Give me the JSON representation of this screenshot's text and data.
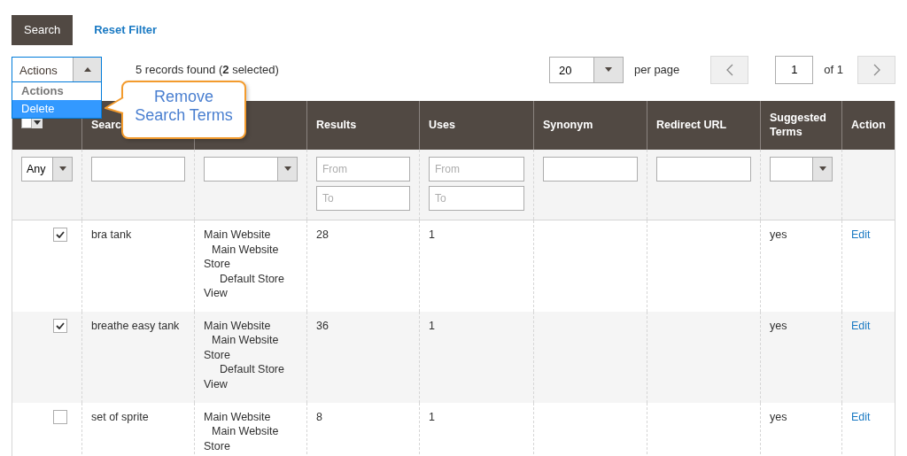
{
  "toolbar": {
    "search_button": "Search",
    "reset_link": "Reset Filter"
  },
  "actions": {
    "label": "Actions",
    "expanded": true,
    "options": [
      {
        "label": "Actions",
        "selected": false
      },
      {
        "label": "Delete",
        "selected": true
      }
    ]
  },
  "records_info": "5 records found (**2** selected)",
  "pager": {
    "per_page": "20",
    "per_page_label": "per page",
    "page": "1",
    "of": "of 1"
  },
  "callout": "Remove Search Terms",
  "table": {
    "columns": [
      {
        "kind": "mass_select"
      },
      {
        "kind": "label",
        "label": "Searc"
      },
      {
        "kind": "hidden"
      },
      {
        "kind": "label",
        "label": "Results"
      },
      {
        "kind": "label",
        "label": "Uses"
      },
      {
        "kind": "label",
        "label": "Synonym"
      },
      {
        "kind": "label",
        "label": "Redirect URL"
      },
      {
        "kind": "label",
        "label": "Suggested Terms"
      },
      {
        "kind": "label",
        "label": "Action"
      }
    ],
    "filters": [
      {
        "kind": "select",
        "value": "Any"
      },
      {
        "kind": "text"
      },
      {
        "kind": "select"
      },
      {
        "kind": "range",
        "inputs": [
          {
            "placeholder": "From"
          },
          {
            "placeholder": "To"
          }
        ]
      },
      {
        "kind": "range",
        "inputs": [
          {
            "placeholder": "From"
          },
          {
            "placeholder": "To"
          }
        ]
      },
      {
        "kind": "text"
      },
      {
        "kind": "text"
      },
      {
        "kind": "select"
      },
      {
        "kind": "none"
      }
    ],
    "rows": [
      {
        "checked": true,
        "query": "bra tank",
        "store": [
          {
            "label": "Main Website",
            "children": [
              {
                "label": "Main Website Store",
                "children": [
                  {
                    "label": "Default Store View"
                  }
                ]
              }
            ]
          }
        ],
        "results": "28",
        "uses": "1",
        "suggested": "yes",
        "action": "Edit"
      },
      {
        "checked": true,
        "query": "breathe easy tank",
        "store": [
          {
            "label": "Main Website",
            "children": [
              {
                "label": "Main Website Store",
                "children": [
                  {
                    "label": "Default Store View"
                  }
                ]
              }
            ]
          }
        ],
        "results": "36",
        "uses": "1",
        "suggested": "yes",
        "action": "Edit"
      },
      {
        "checked": false,
        "query": "set of sprite",
        "store": [
          {
            "label": "Main Website",
            "children": [
              {
                "label": "Main Website Store"
              }
            ]
          }
        ],
        "results": "8",
        "uses": "1",
        "suggested": "yes",
        "action": "Edit"
      }
    ]
  }
}
